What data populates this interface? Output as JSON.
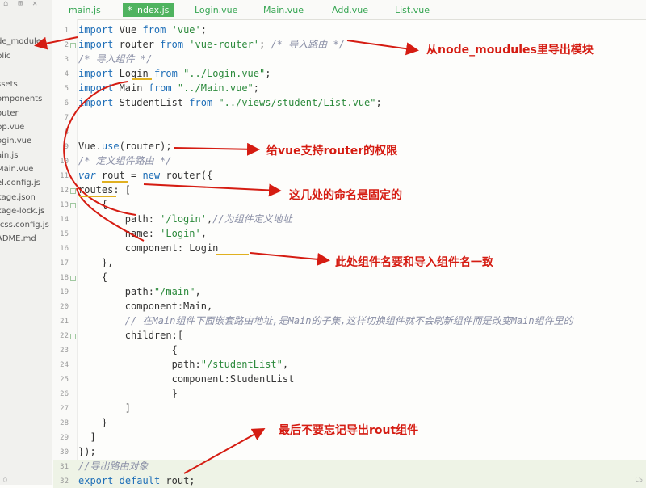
{
  "sidebar": {
    "toolbar": [
      "⌂",
      "⊞",
      "✕"
    ],
    "items": [
      "de_modules",
      "blic",
      "",
      "ssets",
      "omponents",
      "outer",
      "pp.vue",
      "ogin.vue",
      "ain.js",
      "Main.vue",
      "el.config.js",
      "kage.json",
      "kage-lock.js",
      "tcss.config.js",
      "ADME.md"
    ]
  },
  "tabs": [
    "main.js",
    "* index.js",
    "Login.vue",
    "Main.vue",
    "Add.vue",
    "List.vue"
  ],
  "code": {
    "lines": [
      "import Vue from 'vue';",
      "import router from 'vue-router'; /* 导入路由 */",
      "/* 导入组件 */",
      "import Login from \"../Login.vue\";",
      "import Main from \"../Main.vue\";",
      "import StudentList from \"../views/student/List.vue\";",
      "",
      "",
      "Vue.use(router);",
      "/* 定义组件路由 */",
      "var rout = new router({",
      "routes: [",
      "    {",
      "        path: '/login',//为组件定义地址",
      "        name: 'Login',",
      "        component: Login",
      "    },",
      "    {",
      "        path:\"/main\",",
      "        component:Main,",
      "        // 在Main组件下面嵌套路由地址,是Main的子集,这样切换组件就不会刷新组件而是改变Main组件里的",
      "        children:[",
      "                {",
      "                path:\"/studentList\",",
      "                component:StudentList",
      "                }",
      "        ]",
      "    }",
      "  ]",
      "});",
      "//导出路由对象",
      "export default rout;"
    ],
    "line_numbers": [
      "1",
      "2",
      "3",
      "4",
      "5",
      "6",
      "7",
      "8",
      "9",
      "10",
      "11",
      "12",
      "13",
      "14",
      "15",
      "16",
      "17",
      "18",
      "19",
      "20",
      "21",
      "22",
      "23",
      "24",
      "25",
      "26",
      "27",
      "28",
      "29",
      "30",
      "31",
      "32"
    ]
  },
  "annotations": {
    "node_modules": "从node_moudules里导出模块",
    "router_rights": "给vue支持router的权限",
    "fixed_names": "这几处的命名是固定的",
    "component_name": "此处组件名要和导入组件名一致",
    "export_rout": "最后不要忘记导出rout组件"
  },
  "colors": {
    "tab_active": "#4fb35f",
    "annotation": "#d51c12",
    "keyword": "#1f6fb8",
    "string": "#2c8a3c",
    "comment": "#8a8fa6"
  },
  "statusbar": {
    "left_glyph": "◯",
    "right_text": "CS"
  }
}
